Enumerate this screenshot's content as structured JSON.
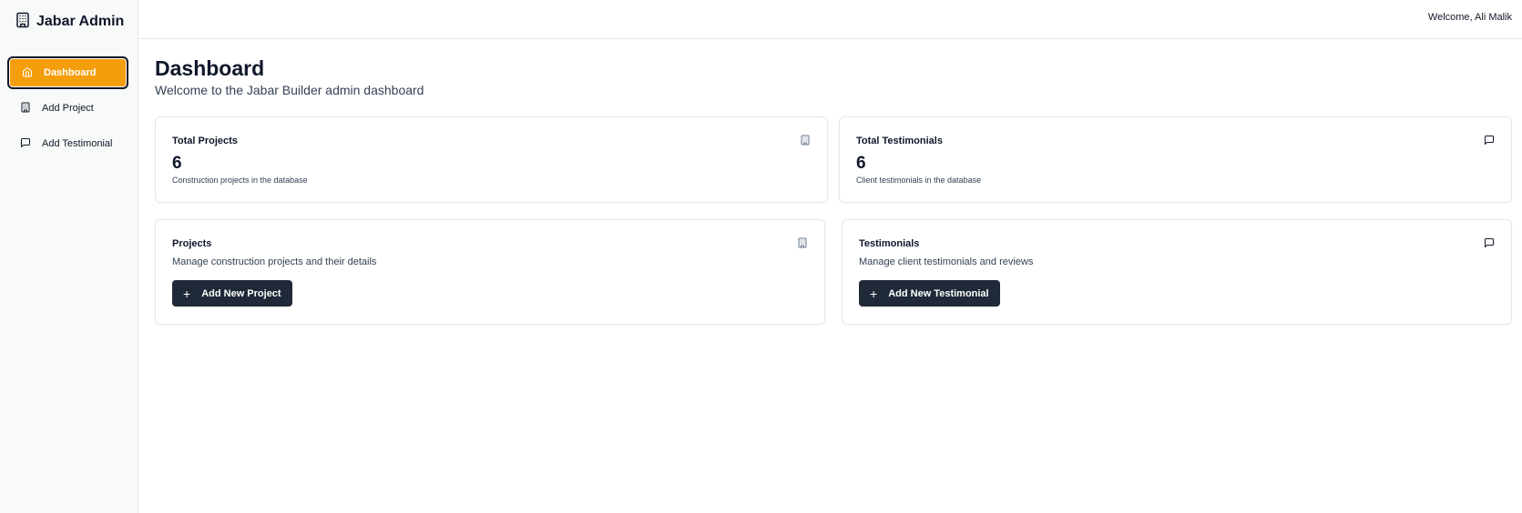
{
  "brand": {
    "title": "Jabar Admin",
    "icon": "building-icon"
  },
  "sidebar": {
    "items": [
      {
        "label": "Dashboard",
        "icon": "home-icon",
        "active": true
      },
      {
        "label": "Add Project",
        "icon": "building-icon",
        "active": false
      },
      {
        "label": "Add Testimonial",
        "icon": "message-square-icon",
        "active": false
      }
    ]
  },
  "header": {
    "welcome": "Welcome, Ali Malik"
  },
  "page": {
    "title": "Dashboard",
    "subtitle": "Welcome to the Jabar Builder admin dashboard"
  },
  "stats": [
    {
      "label": "Total Projects",
      "value": "6",
      "description": "Construction projects in the database",
      "icon": "building-icon"
    },
    {
      "label": "Total Testimonials",
      "value": "6",
      "description": "Client testimonials in the database",
      "icon": "message-square-icon"
    }
  ],
  "actions": [
    {
      "title": "Projects",
      "description": "Manage construction projects and their details",
      "button": "Add New Project",
      "icon": "building-icon"
    },
    {
      "title": "Testimonials",
      "description": "Manage client testimonials and reviews",
      "button": "Add New Testimonial",
      "icon": "message-square-icon"
    }
  ],
  "colors": {
    "accent": "#f59e0b",
    "button": "#1f2937",
    "sidebar_bg": "#f8faf9"
  }
}
